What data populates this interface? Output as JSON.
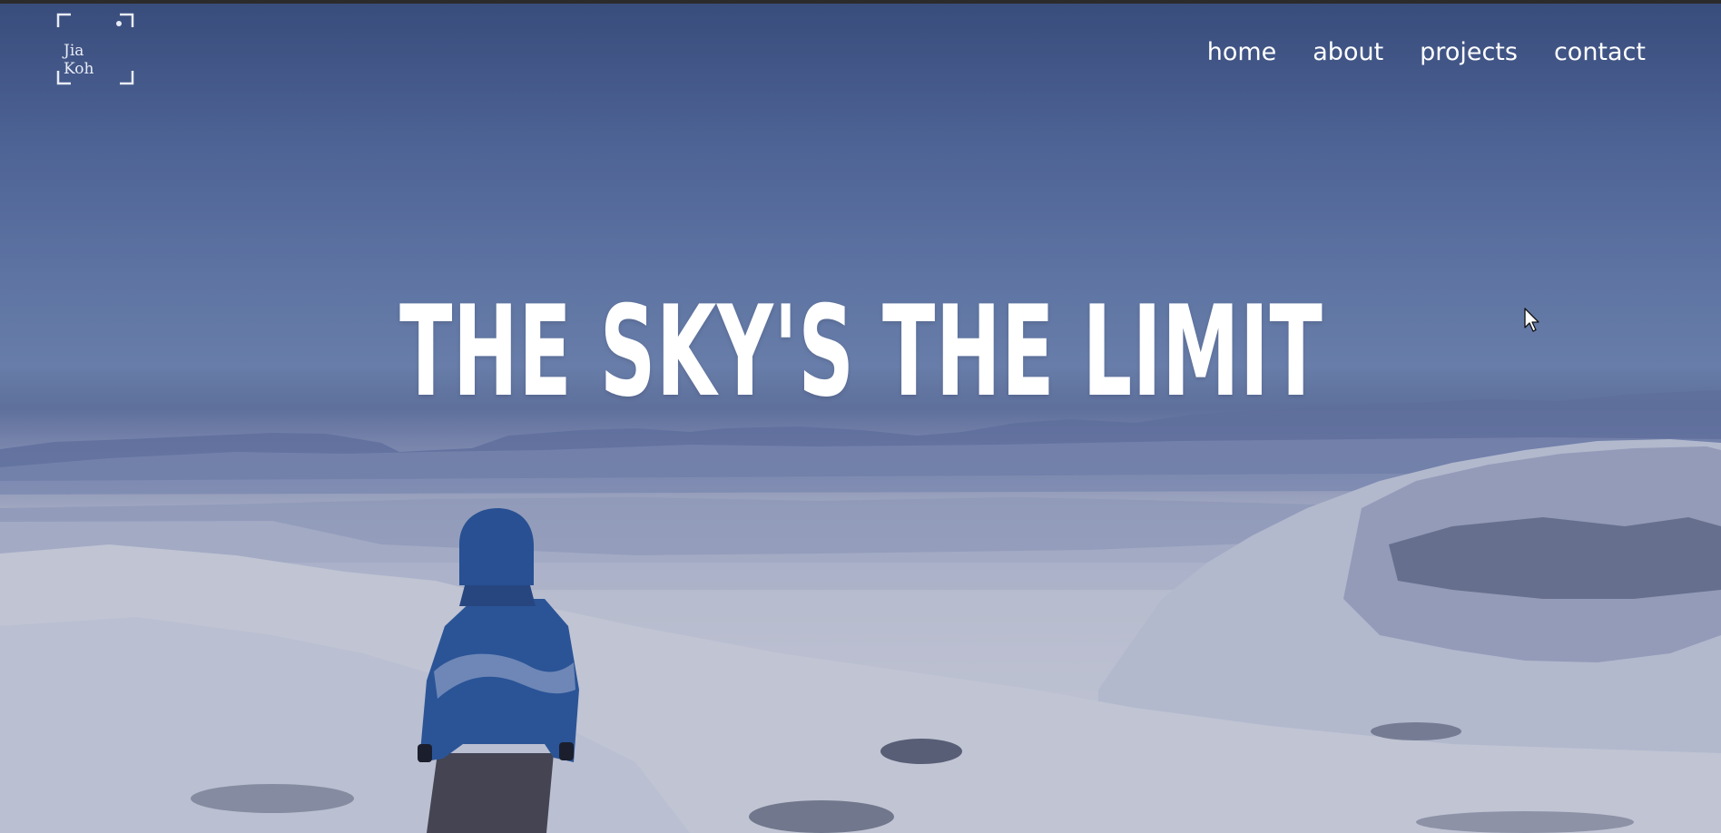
{
  "logo": {
    "line1": "Jia",
    "line2": "Koh"
  },
  "nav": {
    "items": [
      {
        "label": "home"
      },
      {
        "label": "about"
      },
      {
        "label": "projects"
      },
      {
        "label": "contact"
      }
    ]
  },
  "hero": {
    "headline": "THE SKY'S THE LIMIT"
  },
  "colors": {
    "sky_top": "#3f5586",
    "sky_mid": "#7990bd",
    "snow": "#dfe2ee",
    "jacket": "#2c5aa6",
    "text": "#ffffff"
  },
  "icons": {
    "cursor": "mouse-pointer-icon",
    "logo_frame": "corner-bracket-frame"
  }
}
